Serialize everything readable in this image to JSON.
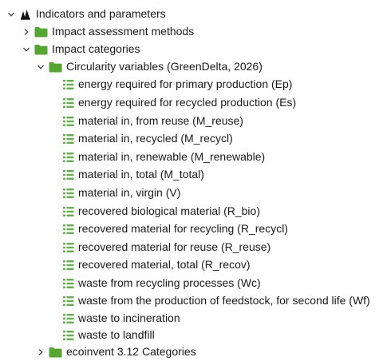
{
  "tree": {
    "root": {
      "label": "Indicators and parameters",
      "icon": "indicators-icon",
      "expanded": true
    },
    "impact_methods": {
      "label": "Impact assessment methods",
      "icon": "folder-icon",
      "expanded": false
    },
    "impact_categories": {
      "label": "Impact categories",
      "icon": "folder-icon",
      "expanded": true
    },
    "circularity": {
      "label": "Circularity variables (GreenDelta, 2026)",
      "icon": "folder-icon",
      "expanded": true
    },
    "items": [
      {
        "label": "energy required for primary production (Ep)"
      },
      {
        "label": "energy required for recycled production (Es)"
      },
      {
        "label": "material in, from reuse (M_reuse)"
      },
      {
        "label": "material in, recycled (M_recycl)"
      },
      {
        "label": "material in, renewable (M_renewable)"
      },
      {
        "label": "material in, total (M_total)"
      },
      {
        "label": "material in, virgin (V)"
      },
      {
        "label": "recovered biological material (R_bio)"
      },
      {
        "label": "recovered material for recycling (R_recycl)"
      },
      {
        "label": "recovered material for reuse (R_reuse)"
      },
      {
        "label": "recovered material, total (R_recov)"
      },
      {
        "label": "waste from recycling processes (Wc)"
      },
      {
        "label": "waste from the production of feedstock, for second life (Wf)"
      },
      {
        "label": "waste to incineration"
      },
      {
        "label": "waste to landfill"
      }
    ],
    "ecoinvent": {
      "label": "ecoinvent 3.12 Categories",
      "icon": "folder-icon",
      "expanded": false
    }
  },
  "colors": {
    "folder": "#55a630",
    "list_icon": "#62b04a",
    "text": "#1a1a1a",
    "chevron": "#444444"
  }
}
